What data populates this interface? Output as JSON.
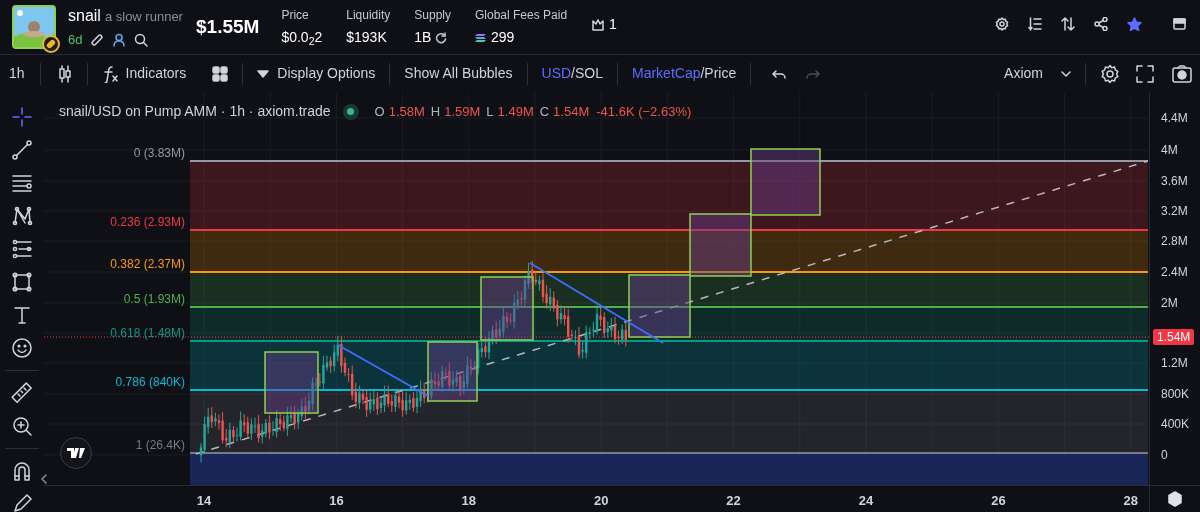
{
  "token": {
    "symbol": "snail",
    "name": "a slow runner",
    "age": "6d",
    "market_cap": "$1.55M"
  },
  "stats": [
    {
      "label": "Price",
      "value": "$0.0$_{2}$2",
      "kind": "plain"
    },
    {
      "label": "Liquidity",
      "value": "$193K",
      "kind": "plain"
    },
    {
      "label": "Supply",
      "value": "1B",
      "kind": "refresh"
    },
    {
      "label": "Global Fees Paid",
      "value": "299",
      "kind": "coin"
    }
  ],
  "top_holders": {
    "count": "1"
  },
  "header_actions": {
    "favorited": true
  },
  "toolbar": {
    "interval": "1h",
    "indicators": "Indicators",
    "display_options": "Display Options",
    "bubbles": "Show All Bubbles",
    "currency": [
      {
        "label": "USD",
        "selected": true
      },
      {
        "label": "SOL",
        "selected": false
      }
    ],
    "metric": [
      {
        "label": "MarketCap",
        "selected": true
      },
      {
        "label": "Price",
        "selected": false
      }
    ],
    "separator": "/",
    "history": [
      {
        "kind": "undo",
        "disabled": false
      },
      {
        "kind": "redo",
        "disabled": true
      }
    ],
    "layout": "Axiom"
  },
  "drawing_tools": [
    {
      "kind": "crosshair",
      "selected": true
    },
    {
      "kind": "trendline",
      "selected": false
    },
    {
      "kind": "hlines",
      "selected": false
    },
    {
      "kind": "pattern",
      "selected": false
    },
    {
      "kind": "fib",
      "selected": false
    },
    {
      "kind": "rectangle",
      "selected": false
    },
    {
      "kind": "text",
      "selected": false
    },
    {
      "kind": "emoji",
      "selected": false
    },
    {
      "kind": "ruler",
      "selected": false
    },
    {
      "kind": "zoom",
      "selected": false
    },
    {
      "kind": "magnet",
      "selected": false
    },
    {
      "kind": "pencil",
      "selected": false
    }
  ],
  "legend": {
    "title": "snail/USD on Pump AMM · 1h · axiom.trade",
    "ohlc": [
      {
        "label": "O",
        "value": "1.58M"
      },
      {
        "label": "H",
        "value": "1.59M"
      },
      {
        "label": "L",
        "value": "1.49M"
      },
      {
        "label": "C",
        "value": "1.54M"
      }
    ],
    "change": "-41.6K (−2.63%)"
  },
  "fib_levels": [
    {
      "label": "0 (3.83M)",
      "color": "#9598a1"
    },
    {
      "label": "0.236 (2.93M)",
      "color": "#f23645"
    },
    {
      "label": "0.382 (2.37M)",
      "color": "#ff9800"
    },
    {
      "label": "0.5 (1.93M)",
      "color": "#4caf50"
    },
    {
      "label": "0.618 (1.48M)",
      "color": "#089981"
    },
    {
      "label": "0.786 (840K)",
      "color": "#00bcd4"
    },
    {
      "label": "1 (26.4K)",
      "color": "#787b86"
    }
  ],
  "y_axis": [
    "4.4M",
    "4M",
    "3.6M",
    "3.2M",
    "2.8M",
    "2.4M",
    "2M",
    "1.2M",
    "800K",
    "400K",
    "0"
  ],
  "price_tag": "1.54M",
  "x_axis": [
    "14",
    "16",
    "18",
    "20",
    "22",
    "24",
    "26",
    "28"
  ]
}
